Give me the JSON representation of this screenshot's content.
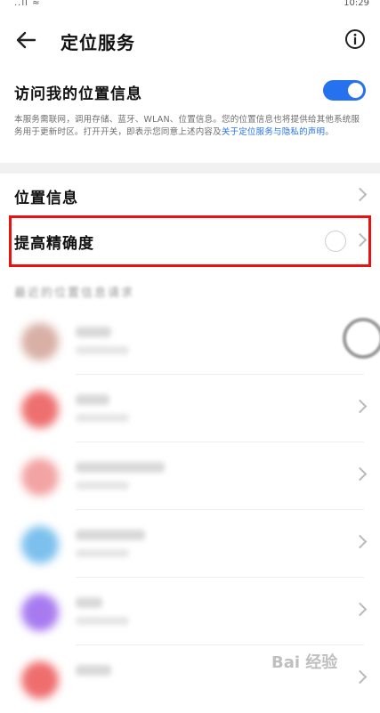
{
  "status": {
    "signal": "..ll ≈",
    "time": "10:29"
  },
  "header": {
    "back_icon": "arrow-left-icon",
    "title": "定位服务",
    "info_icon": "info-icon"
  },
  "location_access": {
    "label": "访问我的位置信息",
    "toggle_on": true,
    "description_prefix": "本服务需联网，调用存储、蓝牙、WLAN、位置信息。您的位置信息也将提供给其他系统服务用于更新时区。打开开关，即表示您同意上述内容及",
    "description_link": "关于定位服务与隐私的声明",
    "description_suffix": "。"
  },
  "menu": [
    {
      "label": "位置信息"
    },
    {
      "label": "提高精确度",
      "radio_checked": false
    }
  ],
  "recent_requests_title": "最近的位置信息请求",
  "recent_requests": [
    {
      "icon_color": "#d8b0a6"
    },
    {
      "icon_color": "#ee6f6f"
    },
    {
      "icon_color": "#f3a3a3"
    },
    {
      "icon_color": "#7cc0ee"
    },
    {
      "icon_color": "#a87af0"
    },
    {
      "icon_color": "#ef6d6d"
    }
  ],
  "colors": {
    "accent": "#2672ee",
    "highlight": "#ec1111"
  },
  "watermark": "Bai 经验"
}
